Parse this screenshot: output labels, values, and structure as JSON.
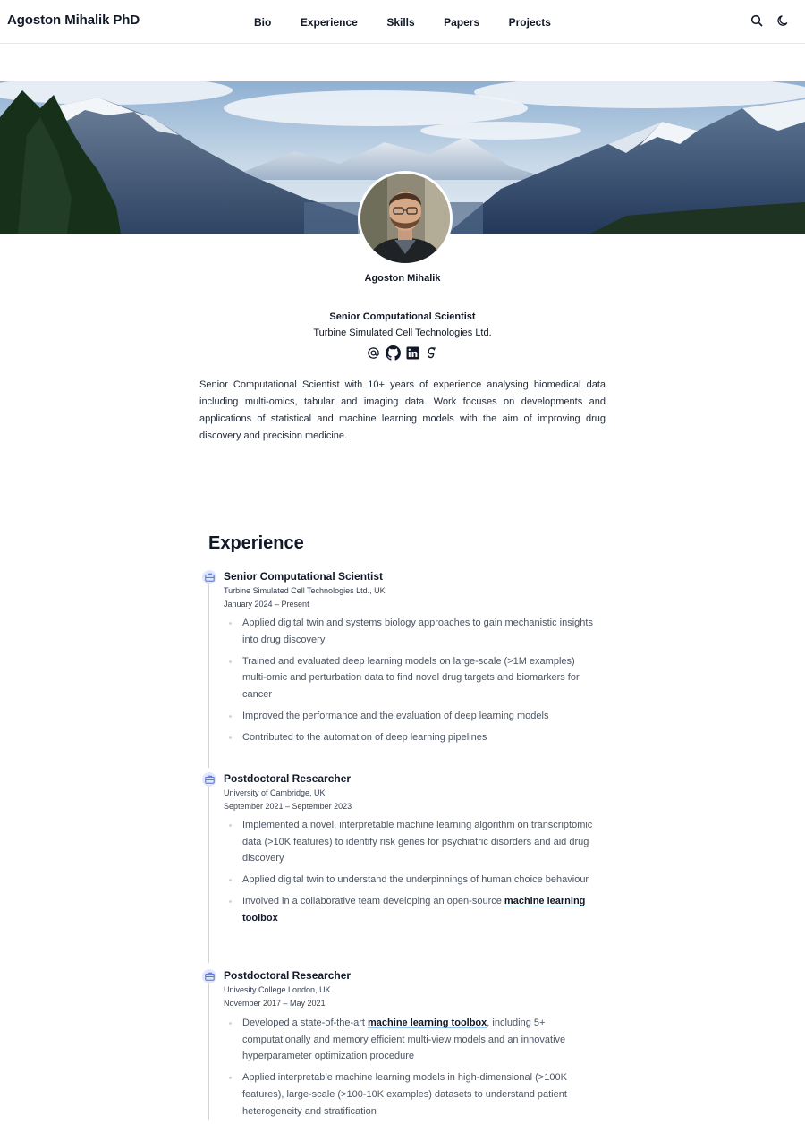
{
  "nav": {
    "brand": "Agoston Mihalik PhD",
    "links": [
      "Bio",
      "Experience",
      "Skills",
      "Papers",
      "Projects"
    ],
    "icons": [
      "search-icon",
      "moon-icon"
    ]
  },
  "profile": {
    "name": "Agoston Mihalik",
    "role": "Senior Computational Scientist",
    "organization": "Turbine Simulated Cell Technologies Ltd.",
    "social_icons": [
      "email-icon",
      "github-icon",
      "linkedin-icon",
      "google-scholar-icon"
    ],
    "bio": "Senior Computational Scientist with 10+ years of experience analysing biomedical data including multi-omics, tabular and imaging data. Work focuses on developments and applications of statistical and machine learning models with the aim of improving drug discovery and precision medicine."
  },
  "experience": {
    "title": "Experience",
    "jobs": [
      {
        "title": "Senior Computational Scientist",
        "organization": "Turbine Simulated Cell Technologies Ltd., UK",
        "dates": "January 2024 – Present",
        "bullets": [
          {
            "text": "Applied digital twin and systems biology approaches to gain mechanistic insights into drug discovery"
          },
          {
            "text": "Trained and evaluated deep learning models on large-scale (>1M examples) multi-omic and perturbation data to find novel drug targets and biomarkers for cancer"
          },
          {
            "text": "Improved the performance and the evaluation of deep learning models"
          },
          {
            "text": "Contributed to the automation of deep learning pipelines"
          }
        ]
      },
      {
        "title": "Postdoctoral Researcher",
        "organization": "University of Cambridge, UK",
        "dates": "September 2021 – September 2023",
        "bullets": [
          {
            "text": "Implemented a novel, interpretable machine learning algorithm on transcriptomic data (>10K features) to identify risk genes for psychiatric disorders and aid drug discovery"
          },
          {
            "text": "Applied digital twin to understand the underpinnings of human choice behaviour"
          },
          {
            "before": "Involved in a collaborative team developing an open-source ",
            "link": "machine learning toolbox",
            "after": ""
          }
        ]
      },
      {
        "title": "Postdoctoral Researcher",
        "organization": "Univesity College London, UK",
        "dates": "November 2017 – May 2021",
        "bullets": [
          {
            "before": "Developed a state-of-the-art ",
            "link": "machine learning toolbox",
            "after": ", including 5+ computationally and memory efficient multi-view models and an innovative hyperparameter optimization procedure"
          },
          {
            "text": "Applied interpretable machine learning models in high-dimensional (>100K features), large-scale (>100-10K examples) datasets to understand patient heterogeneity and stratification"
          }
        ]
      }
    ]
  }
}
